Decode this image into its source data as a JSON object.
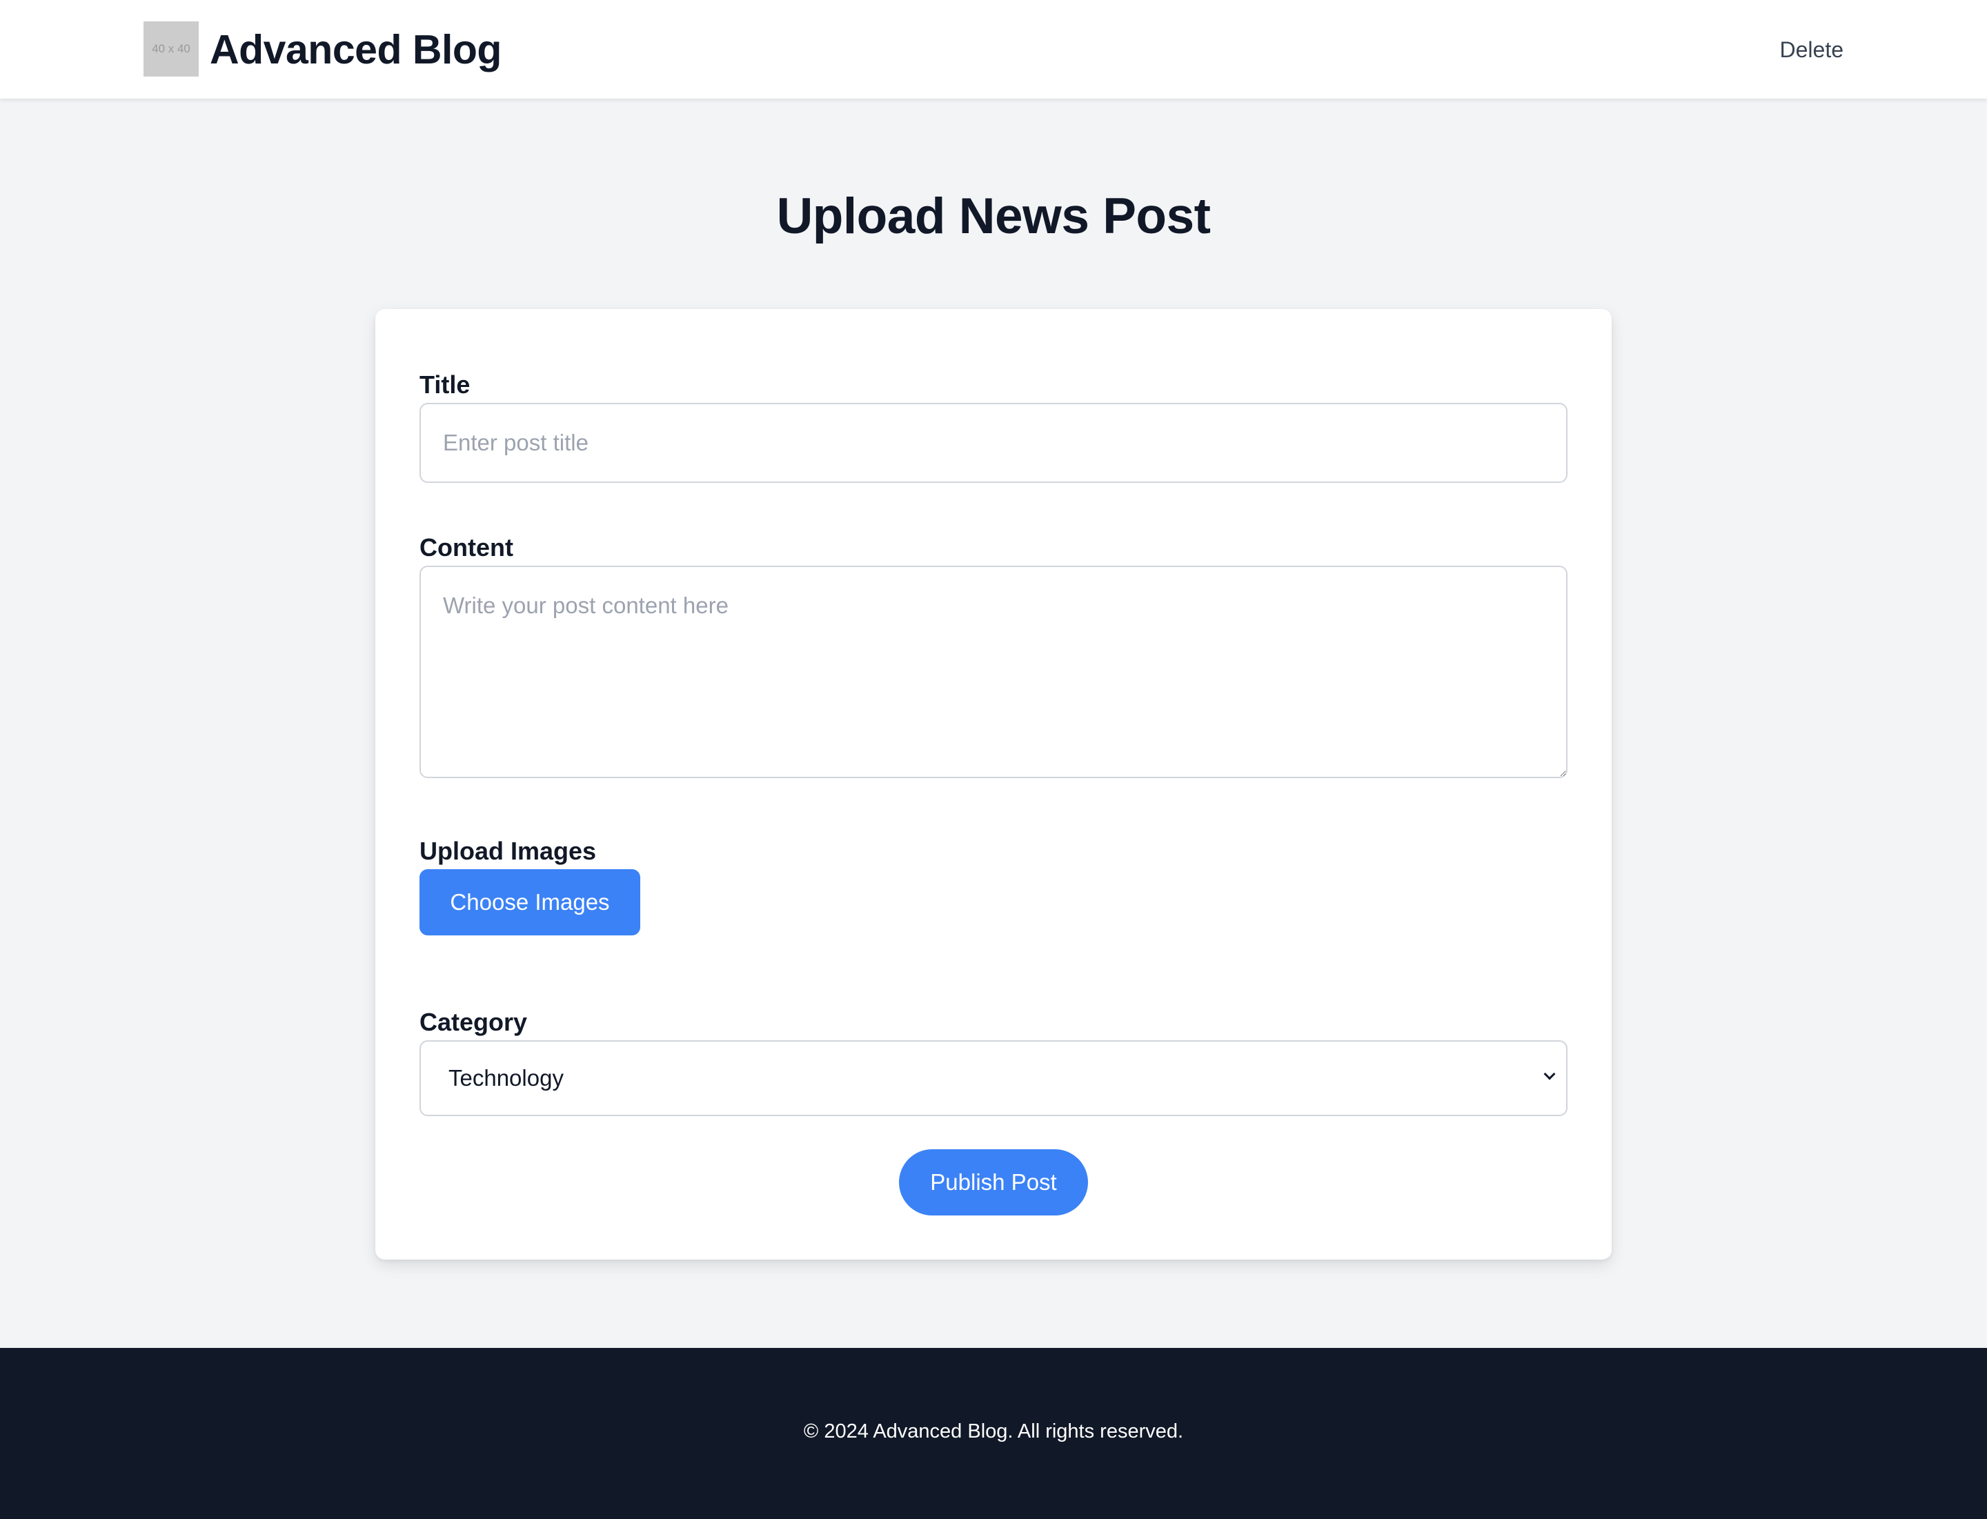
{
  "header": {
    "logo_text": "40 x 40",
    "brand": "Advanced Blog",
    "nav_delete": "Delete"
  },
  "main": {
    "page_title": "Upload News Post"
  },
  "form": {
    "title_label": "Title",
    "title_placeholder": "Enter post title",
    "title_value": "",
    "content_label": "Content",
    "content_placeholder": "Write your post content here",
    "content_value": "",
    "images_label": "Upload Images",
    "choose_images_label": "Choose Images",
    "category_label": "Category",
    "category_selected": "Technology",
    "publish_label": "Publish Post"
  },
  "footer": {
    "text": "© 2024 Advanced Blog. All rights reserved."
  },
  "colors": {
    "accent": "#3b82f6",
    "background": "#f3f4f6",
    "footer": "#111827",
    "text": "#111827"
  },
  "icons": {
    "select_arrow": "chevron-down-icon"
  }
}
